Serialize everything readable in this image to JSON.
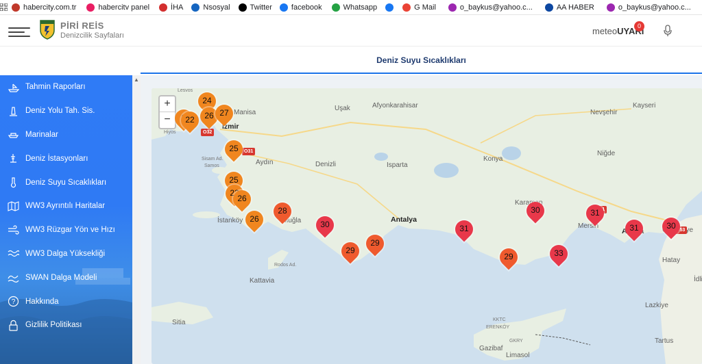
{
  "bookmarks": [
    {
      "label": "habercity.com.tr",
      "icon": "globe-icon",
      "color": "#c0392b"
    },
    {
      "label": "habercitv panel",
      "icon": "te-icon",
      "color": "#e91e63"
    },
    {
      "label": "İHA",
      "icon": "iha-icon",
      "color": "#d32f2f"
    },
    {
      "label": "Nsosyal",
      "icon": "n-icon",
      "color": "#1565c0"
    },
    {
      "label": "Twitter",
      "icon": "x-icon",
      "color": "#000000"
    },
    {
      "label": "facebook",
      "icon": "facebook-icon",
      "color": "#1877f2"
    },
    {
      "label": "Whatsapp",
      "icon": "whatsapp-icon",
      "color": "#25a244"
    },
    {
      "label": "",
      "icon": "facebook-icon",
      "color": "#1877f2"
    },
    {
      "label": "G Mail",
      "icon": "gmail-icon",
      "color": "#ea4335"
    },
    {
      "label": "o_baykus@yahoo.c...",
      "icon": "mail-icon",
      "color": "#9c27b0"
    },
    {
      "label": "AA HABER",
      "icon": "aa-icon",
      "color": "#0d47a1"
    },
    {
      "label": "o_baykus@yahoo.c...",
      "icon": "mail-icon",
      "color": "#9c27b0"
    },
    {
      "label": "o_baykus@yahoo.c...",
      "icon": "mail-icon",
      "color": "#9c27b0"
    }
  ],
  "header": {
    "brand_title": "PİRİ REİS",
    "brand_subtitle": "Denizcilik Sayfaları",
    "meteo_prefix": "meteo",
    "meteo_suffix": "UYARI",
    "notification_count": "0"
  },
  "page_title": "Deniz Suyu Sıcaklıkları",
  "sidebar": {
    "items": [
      {
        "label": "Tahmin Raporları",
        "icon": "ship-report-icon"
      },
      {
        "label": "Deniz Yolu Tah. Sis.",
        "icon": "lighthouse-icon"
      },
      {
        "label": "Marinalar",
        "icon": "boat-icon"
      },
      {
        "label": "Deniz İstasyonları",
        "icon": "station-icon"
      },
      {
        "label": "Deniz Suyu Sıcaklıkları",
        "icon": "thermometer-icon"
      },
      {
        "label": "WW3 Ayrıntılı Haritalar",
        "icon": "map-icon"
      },
      {
        "label": "WW3 Rüzgar Yön ve Hızı",
        "icon": "wind-icon"
      },
      {
        "label": "WW3 Dalga Yüksekliği",
        "icon": "wave-icon"
      },
      {
        "label": "SWAN Dalga Modeli",
        "icon": "swan-wave-icon"
      },
      {
        "label": "Hakkında",
        "icon": "question-icon"
      },
      {
        "label": "Gizlilik Politikası",
        "icon": "lock-icon"
      }
    ]
  },
  "map": {
    "zoom_in": "+",
    "zoom_out": "−",
    "cities": [
      "Lesvos",
      "Manisa",
      "Uşak",
      "Afyonkarahisar",
      "Nevşehir",
      "Kayseri",
      "İzmir",
      "Hiyos",
      "Sisam Ad.",
      "Samos",
      "Aydın",
      "Denizli",
      "Isparta",
      "Konya",
      "Niğde",
      "Muğla",
      "İstanköy",
      "Antalya",
      "Karaman",
      "Mersin",
      "Adana",
      "Osmaniye",
      "Kattavia",
      "Hatay",
      "İdli",
      "Lazkiye",
      "Sitia",
      "Gazibaf",
      "Limasol",
      "Tartus",
      "Rodos Ad.",
      "KKTC",
      "ERENKÖY",
      "GKRY"
    ],
    "roads": [
      "O32",
      "O31",
      "O21",
      "O53"
    ],
    "markers": [
      "24",
      "2",
      "22",
      "26",
      "27",
      "25",
      "25",
      "22",
      "26",
      "28",
      "26",
      "30",
      "30",
      "29",
      "29",
      "31",
      "29",
      "33",
      "31",
      "31",
      "30"
    ]
  }
}
